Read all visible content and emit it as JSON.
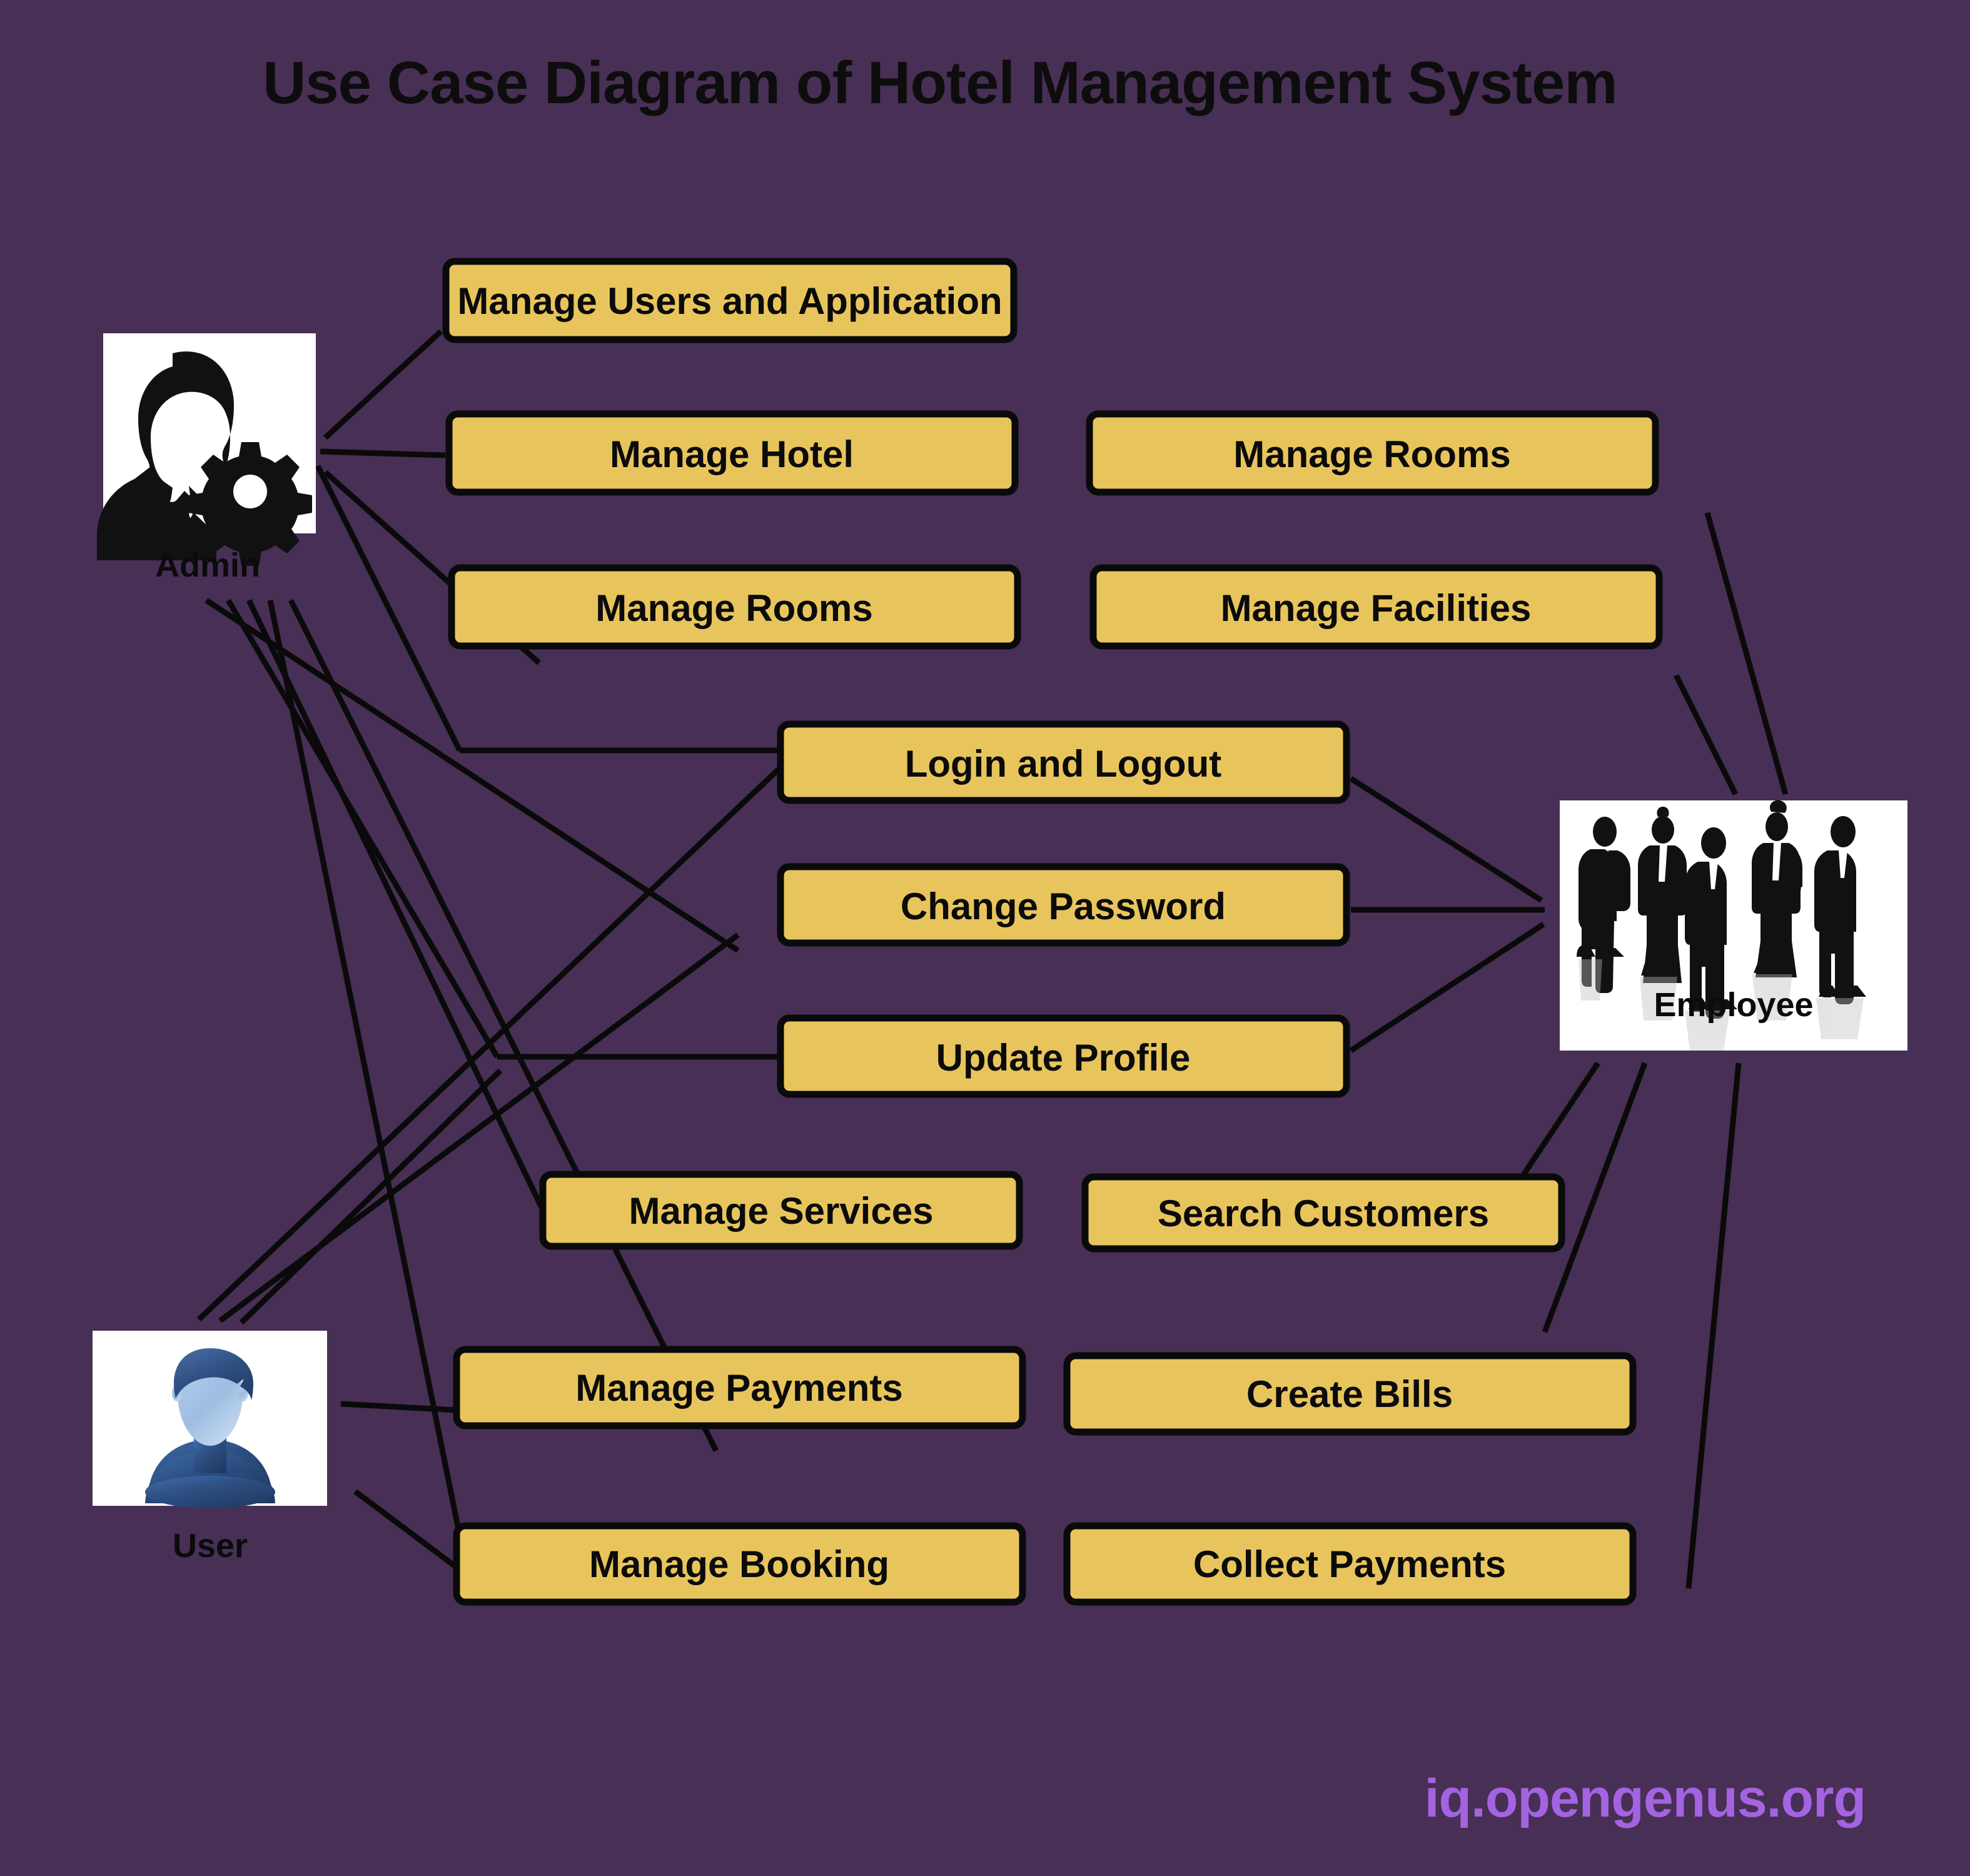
{
  "page": {
    "title": "Use Case Diagram of Hotel Management System",
    "background_color": "#472F55",
    "watermark": "iq.opengenus.org",
    "watermark_color": "#A463E0"
  },
  "style": {
    "usecase_fill": "#E8C55C",
    "usecase_border": "#0A0A0A",
    "connector_color": "#0A0A0A",
    "actor_plate_color": "#FFFFFF",
    "text_color": "#0B0B0B"
  },
  "actors": [
    {
      "id": "admin",
      "label": "Admin",
      "icon": "user-gear-icon",
      "label_position": "below"
    },
    {
      "id": "user",
      "label": "User",
      "icon": "user-avatar-icon",
      "label_position": "below"
    },
    {
      "id": "employee",
      "label": "Employee",
      "icon": "business-people-group-icon",
      "label_position": "inside"
    }
  ],
  "use_cases": [
    {
      "id": "uc-manage-users-and-application",
      "label": "Manage Users and Application"
    },
    {
      "id": "uc-manage-hotel",
      "label": "Manage Hotel"
    },
    {
      "id": "uc-manage-rooms-right",
      "label": "Manage Rooms"
    },
    {
      "id": "uc-manage-rooms-left",
      "label": "Manage Rooms"
    },
    {
      "id": "uc-manage-facilities",
      "label": "Manage Facilities"
    },
    {
      "id": "uc-login-and-logout",
      "label": "Login and Logout"
    },
    {
      "id": "uc-change-password",
      "label": "Change Password"
    },
    {
      "id": "uc-update-profile",
      "label": "Update Profile"
    },
    {
      "id": "uc-manage-services",
      "label": "Manage Services"
    },
    {
      "id": "uc-search-customers",
      "label": "Search Customers"
    },
    {
      "id": "uc-manage-payments",
      "label": "Manage Payments"
    },
    {
      "id": "uc-create-bills",
      "label": "Create Bills"
    },
    {
      "id": "uc-manage-booking",
      "label": "Manage Booking"
    },
    {
      "id": "uc-collect-payments",
      "label": "Collect Payments"
    }
  ],
  "associations": [
    {
      "actor": "admin",
      "use_case": "uc-manage-users-and-application"
    },
    {
      "actor": "admin",
      "use_case": "uc-manage-hotel"
    },
    {
      "actor": "admin",
      "use_case": "uc-manage-rooms-left"
    },
    {
      "actor": "admin",
      "use_case": "uc-login-and-logout"
    },
    {
      "actor": "admin",
      "use_case": "uc-change-password"
    },
    {
      "actor": "admin",
      "use_case": "uc-update-profile"
    },
    {
      "actor": "admin",
      "use_case": "uc-manage-services"
    },
    {
      "actor": "admin",
      "use_case": "uc-manage-booking"
    },
    {
      "actor": "user",
      "use_case": "uc-login-and-logout"
    },
    {
      "actor": "user",
      "use_case": "uc-change-password"
    },
    {
      "actor": "user",
      "use_case": "uc-update-profile"
    },
    {
      "actor": "user",
      "use_case": "uc-manage-payments"
    },
    {
      "actor": "user",
      "use_case": "uc-manage-booking"
    },
    {
      "actor": "employee",
      "use_case": "uc-manage-rooms-right"
    },
    {
      "actor": "employee",
      "use_case": "uc-manage-facilities"
    },
    {
      "actor": "employee",
      "use_case": "uc-login-and-logout"
    },
    {
      "actor": "employee",
      "use_case": "uc-change-password"
    },
    {
      "actor": "employee",
      "use_case": "uc-update-profile"
    },
    {
      "actor": "employee",
      "use_case": "uc-search-customers"
    },
    {
      "actor": "employee",
      "use_case": "uc-create-bills"
    },
    {
      "actor": "employee",
      "use_case": "uc-collect-payments"
    }
  ]
}
